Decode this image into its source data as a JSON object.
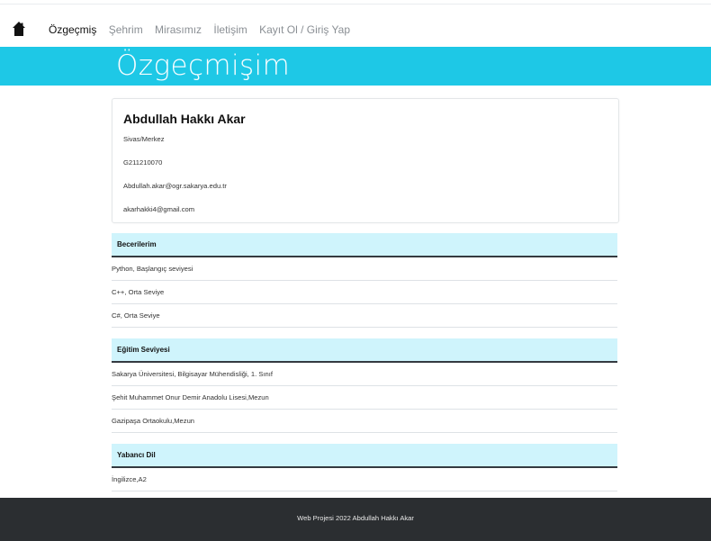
{
  "nav": {
    "brand_icon": "home-icon",
    "items": [
      {
        "label": "Özgeçmiş",
        "active": true
      },
      {
        "label": "Şehrim",
        "active": false
      },
      {
        "label": "Mirasımız",
        "active": false
      },
      {
        "label": "İletişim",
        "active": false
      },
      {
        "label": "Kayıt Ol / Giriş Yap",
        "active": false
      }
    ]
  },
  "hero": {
    "title": "Özgeçmişim",
    "color": "#1ec8e6"
  },
  "profile": {
    "name": "Abdullah Hakkı Akar",
    "location": "Sivas/Merkez",
    "student_no": "G211210070",
    "email_school": "Abdullah.akar@ogr.sakarya.edu.tr",
    "email_personal": "akarhakki4@gmail.com"
  },
  "sections": [
    {
      "title": "Becerilerim",
      "items": [
        "Python, Başlangıç seviyesi",
        "C++, Orta Seviye",
        "C#, Orta Seviye"
      ]
    },
    {
      "title": "Eğitim Seviyesi",
      "items": [
        "Sakarya Üniversitesi, Bilgisayar Mühendisliği, 1. Sınıf",
        "Şehit Muhammet Onur Demir Anadolu Lisesi,Mezun",
        "Gazipaşa Ortaokulu,Mezun"
      ]
    },
    {
      "title": "Yabancı Dil",
      "items": [
        "İngilizce,A2"
      ]
    }
  ],
  "footer": {
    "text": "Web Projesi 2022 Abdullah Hakkı Akar"
  }
}
